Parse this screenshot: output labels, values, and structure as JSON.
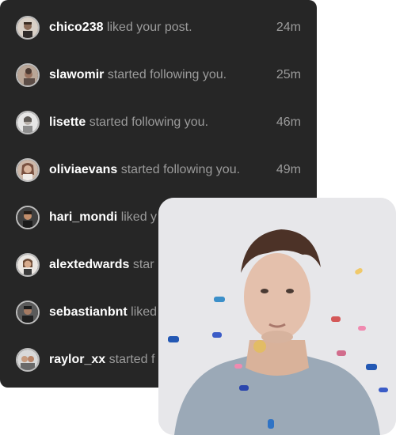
{
  "notifications": [
    {
      "username": "chico238",
      "action": "liked your post.",
      "time": "24m",
      "avatar": "person-avatar-1"
    },
    {
      "username": "slawomir",
      "action": "started following you.",
      "time": "25m",
      "avatar": "person-avatar-2"
    },
    {
      "username": "lisette",
      "action": "started following you.",
      "time": "46m",
      "avatar": "person-avatar-3"
    },
    {
      "username": "oliviaevans",
      "action": "started following you.",
      "time": "49m",
      "avatar": "person-avatar-4"
    },
    {
      "username": "hari_mondi",
      "action": "liked y",
      "time": "",
      "avatar": "person-avatar-5"
    },
    {
      "username": "alextedwards",
      "action": "star",
      "time": "",
      "avatar": "person-avatar-6"
    },
    {
      "username": "sebastianbnt",
      "action": "liked",
      "time": "",
      "avatar": "person-avatar-7"
    },
    {
      "username": "raylor_xx",
      "action": "started f",
      "time": "",
      "avatar": "person-avatar-8"
    }
  ],
  "photo": {
    "subject": "young man portrait with confetti",
    "background_color": "#e7e7ea"
  },
  "colors": {
    "panel_bg": "#262626",
    "username": "#ffffff",
    "secondary_text": "#9b9b9b",
    "avatar_ring": "#bdbdbd"
  }
}
